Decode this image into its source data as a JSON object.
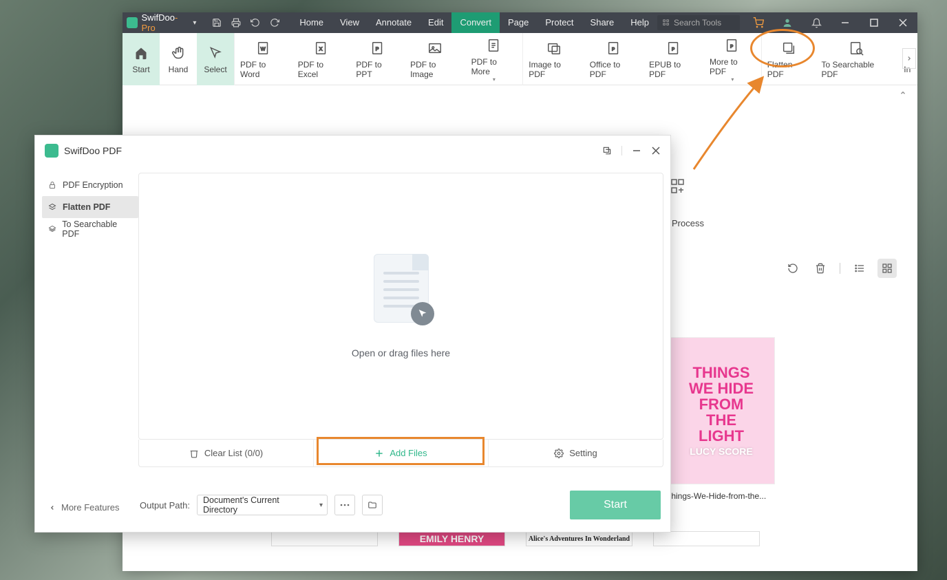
{
  "app": {
    "brand": "SwifDoo",
    "pro": "-Pro"
  },
  "menu": {
    "home": "Home",
    "view": "View",
    "annotate": "Annotate",
    "edit": "Edit",
    "convert": "Convert",
    "page": "Page",
    "protect": "Protect",
    "share": "Share",
    "help": "Help"
  },
  "search_placeholder": "Search Tools",
  "ribbon": {
    "start": "Start",
    "hand": "Hand",
    "select": "Select",
    "pdf_to_word": "PDF to Word",
    "pdf_to_excel": "PDF to Excel",
    "pdf_to_ppt": "PDF to PPT",
    "pdf_to_image": "PDF to Image",
    "pdf_to_more": "PDF to More",
    "image_to_pdf": "Image to PDF",
    "office_to_pdf": "Office to PDF",
    "epub_to_pdf": "EPUB to PDF",
    "more_to_pdf": "More to PDF",
    "flatten_pdf": "Flatten PDF",
    "to_searchable": "To Searchable PDF",
    "in": "In"
  },
  "workspace": {
    "batch_process": "Process",
    "book_title": "Things-We-Hide-from-the...",
    "book_lines": [
      "THINGS",
      "WE HIDE",
      "FROM",
      "THE",
      "LIGHT"
    ],
    "book_author": "LUCY SCORE",
    "row2_emily": "EMILY HENRY",
    "row2_alice": "Alice's Adventures In Wonderland"
  },
  "modal": {
    "title": "SwifDoo PDF",
    "side_encryption": "PDF Encryption",
    "side_flatten": "Flatten PDF",
    "side_searchable": "To Searchable PDF",
    "drop_hint": "Open or drag files here",
    "clear_list": "Clear List (0/0)",
    "add_files": "Add Files",
    "setting": "Setting",
    "output_label": "Output Path:",
    "output_value": "Document's Current Directory",
    "start": "Start",
    "more_features": "More Features"
  }
}
